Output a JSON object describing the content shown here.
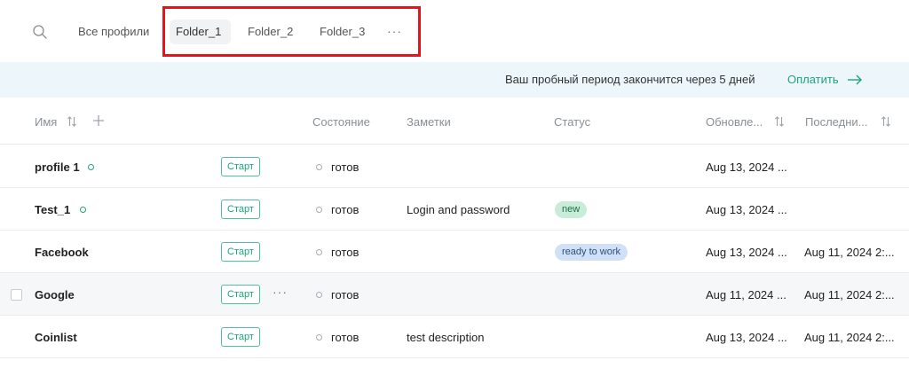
{
  "tabs": {
    "all": "Все профили",
    "folders": [
      "Folder_1",
      "Folder_2",
      "Folder_3"
    ],
    "more": "···"
  },
  "banner": {
    "text": "Ваш пробный период закончится через 5 дней",
    "link": "Оплатить"
  },
  "columns": {
    "name": "Имя",
    "state": "Состояние",
    "notes": "Заметки",
    "status": "Статус",
    "updated": "Обновле...",
    "last": "Последни..."
  },
  "rows": [
    {
      "name": "profile 1",
      "start": "Старт",
      "state": "готов",
      "notes": "",
      "status": "",
      "updated": "Aug 13, 2024 ...",
      "last": ""
    },
    {
      "name": "Test_1",
      "start": "Старт",
      "state": "готов",
      "notes": "Login and password",
      "status": "new",
      "updated": "Aug 13, 2024 ...",
      "last": ""
    },
    {
      "name": "Facebook",
      "start": "Старт",
      "state": "готов",
      "notes": "",
      "status": "ready to work",
      "updated": "Aug 13, 2024 ...",
      "last": "Aug 11, 2024 2:..."
    },
    {
      "name": "Google",
      "start": "Старт",
      "more": "···",
      "state": "готов",
      "notes": "",
      "status": "",
      "updated": "Aug 11, 2024 ...",
      "last": "Aug 11, 2024 2:..."
    },
    {
      "name": "Coinlist",
      "start": "Старт",
      "state": "готов",
      "notes": "test description",
      "status": "",
      "updated": "Aug 13, 2024 ...",
      "last": "Aug 11, 2024 2:..."
    }
  ],
  "colors": {
    "accent": "#1aa67c",
    "banner_bg": "#edf6fb",
    "highlight": "#e8131a",
    "badge_new": "#c9ecd9",
    "badge_ready": "#cfe0f7"
  },
  "icons": {
    "search": "search-icon",
    "arrow": "arrow-right-icon",
    "sort": "sort-icon",
    "add": "plus-icon"
  }
}
